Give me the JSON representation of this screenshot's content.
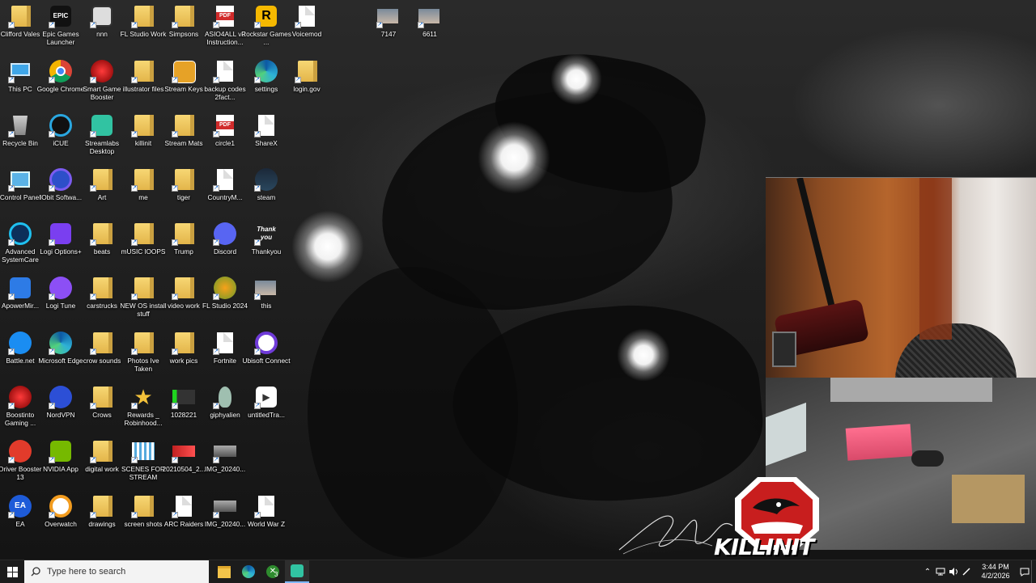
{
  "desktop": {
    "icons": [
      {
        "label": "Clifford Vales",
        "type": "folder"
      },
      {
        "label": "Epic Games Launcher",
        "type": "epic"
      },
      {
        "label": "nnn",
        "type": "nnn"
      },
      {
        "label": "FL Studio Work",
        "type": "folder"
      },
      {
        "label": "Simpsons",
        "type": "folder"
      },
      {
        "label": "ASIO4ALL v2 Instruction...",
        "type": "pdf"
      },
      {
        "label": "Rockstar Games ...",
        "type": "rockstar"
      },
      {
        "label": "Voicemod",
        "type": "doc"
      },
      {
        "label": "7147",
        "type": "photo"
      },
      {
        "label": "6611",
        "type": "photo"
      },
      {
        "label": "This PC",
        "type": "thispc"
      },
      {
        "label": "Google Chrome",
        "type": "chrome"
      },
      {
        "label": "Smart Game Booster",
        "type": "booster"
      },
      {
        "label": "illustrator files",
        "type": "folder"
      },
      {
        "label": "Stream Keys",
        "type": "keys"
      },
      {
        "label": "backup codes 2fact...",
        "type": "doc"
      },
      {
        "label": "settings",
        "type": "edge"
      },
      {
        "label": "login.gov",
        "type": "folder"
      },
      {
        "label": "Recycle Bin",
        "type": "recycle"
      },
      {
        "label": "iCUE",
        "type": "icue"
      },
      {
        "label": "Streamlabs Desktop",
        "type": "streamlabs"
      },
      {
        "label": "killinit",
        "type": "folder"
      },
      {
        "label": "Stream Mats",
        "type": "folder"
      },
      {
        "label": "circle1",
        "type": "pdf"
      },
      {
        "label": "ShareX",
        "type": "doc"
      },
      {
        "label": "Control Panel",
        "type": "control"
      },
      {
        "label": "IObit Softwa...",
        "type": "iobit"
      },
      {
        "label": "Art",
        "type": "folder"
      },
      {
        "label": "me",
        "type": "folder"
      },
      {
        "label": "tiger",
        "type": "folder"
      },
      {
        "label": "CountryM...",
        "type": "doc"
      },
      {
        "label": "steam",
        "type": "steam"
      },
      {
        "label": "Advanced SystemCare",
        "type": "asc"
      },
      {
        "label": "Logi Options+",
        "type": "logi"
      },
      {
        "label": "beats",
        "type": "folder"
      },
      {
        "label": "mUSIC lOOPS",
        "type": "folder"
      },
      {
        "label": "Trump",
        "type": "folder"
      },
      {
        "label": "Discord",
        "type": "discord"
      },
      {
        "label": "Thankyou",
        "type": "thankyou"
      },
      {
        "label": "ApowerMir...",
        "type": "apower"
      },
      {
        "label": "Logi Tune",
        "type": "logitune"
      },
      {
        "label": "carstrucks",
        "type": "folder"
      },
      {
        "label": "NEW OS install stuff",
        "type": "folder"
      },
      {
        "label": "video work",
        "type": "folder"
      },
      {
        "label": "FL Studio 2024",
        "type": "flstudio"
      },
      {
        "label": "this",
        "type": "photo"
      },
      {
        "label": "Battle.net",
        "type": "battlenet"
      },
      {
        "label": "Microsoft Edge",
        "type": "edge"
      },
      {
        "label": "crow sounds",
        "type": "folder"
      },
      {
        "label": "Photos Ive Taken",
        "type": "folder"
      },
      {
        "label": "work pics",
        "type": "folder"
      },
      {
        "label": "Fortnite",
        "type": "doc"
      },
      {
        "label": "Ubisoft Connect",
        "type": "ubisoft"
      },
      {
        "label": "Boostinto Gaming ...",
        "type": "booster"
      },
      {
        "label": "NordVPN",
        "type": "nordvpn"
      },
      {
        "label": "Crows",
        "type": "folder"
      },
      {
        "label": "Rewards _ Robinhood...",
        "type": "star"
      },
      {
        "label": "1028221",
        "type": "greenimg"
      },
      {
        "label": "giphyalien",
        "type": "alien"
      },
      {
        "label": "untitledTra...",
        "type": "video"
      },
      {
        "label": "Driver Booster 13",
        "type": "driverbooster"
      },
      {
        "label": "NVIDIA App",
        "type": "nvidia"
      },
      {
        "label": "digital work",
        "type": "folder"
      },
      {
        "label": "SCENES FOR STREAM",
        "type": "scenes"
      },
      {
        "label": "20210504_2...",
        "type": "redimg"
      },
      {
        "label": "IMG_20240...",
        "type": "carimg"
      },
      {
        "label": "EA",
        "type": "ea"
      },
      {
        "label": "Overwatch",
        "type": "overwatch"
      },
      {
        "label": "drawings",
        "type": "folder"
      },
      {
        "label": "screen shots",
        "type": "folder"
      },
      {
        "label": "ARC Raiders",
        "type": "doc"
      },
      {
        "label": "IMG_20240...",
        "type": "carimg"
      },
      {
        "label": "World War Z",
        "type": "doc"
      }
    ]
  },
  "overlay": {
    "logo_text": "KILLINIT"
  },
  "taskbar": {
    "search_placeholder": "Type here to search",
    "xbox_badge": "3",
    "clock_time": "3:44 PM",
    "clock_date": "4/2/2026"
  },
  "colors": {
    "taskbar_bg": "#1c1c1c",
    "accent_blue": "#0078d4"
  }
}
